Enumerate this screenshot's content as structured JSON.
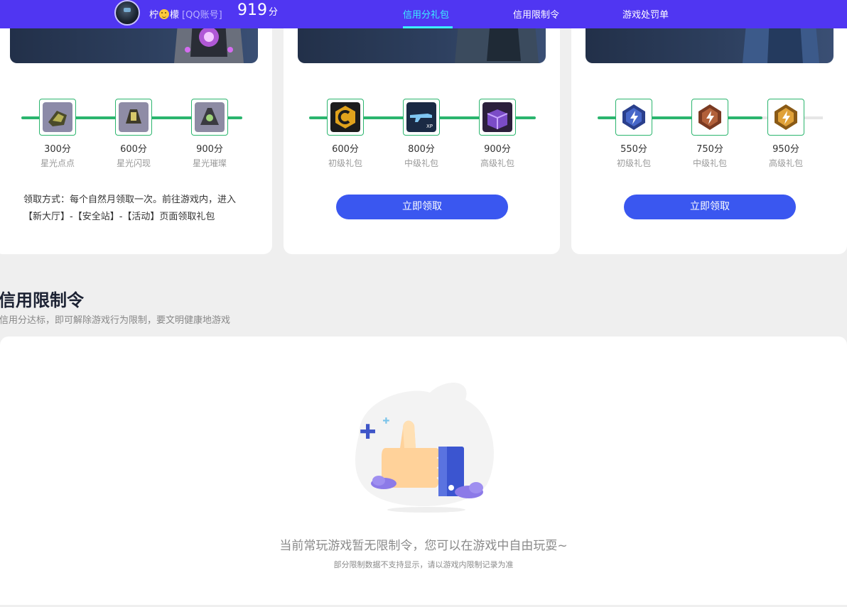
{
  "header": {
    "user_name_prefix": "柠",
    "user_name_suffix": "檬",
    "account_label": "[QQ账号]",
    "score": "919",
    "score_unit": "分",
    "nav": [
      {
        "label": "信用分礼包",
        "active": true
      },
      {
        "label": "信用限制令",
        "active": false
      },
      {
        "label": "游戏处罚单",
        "active": false
      }
    ]
  },
  "gift_cards": [
    {
      "tiers": [
        {
          "points": "300分",
          "name": "星光点点",
          "icon": "starlight-item-1"
        },
        {
          "points": "600分",
          "name": "星光闪现",
          "icon": "starlight-item-2"
        },
        {
          "points": "900分",
          "name": "星光璀璨",
          "icon": "starlight-item-3"
        }
      ],
      "howto": "领取方式：每个自然月领取一次。前往游戏内，进入【新大厅】-【安全站】-【活动】页面领取礼包"
    },
    {
      "tiers": [
        {
          "points": "600分",
          "name": "初级礼包",
          "icon": "c-badge-icon"
        },
        {
          "points": "800分",
          "name": "中级礼包",
          "icon": "rifle-xp-icon"
        },
        {
          "points": "900分",
          "name": "高级礼包",
          "icon": "purple-crate-icon"
        }
      ],
      "button": "立即领取"
    },
    {
      "tiers": [
        {
          "points": "550分",
          "name": "初级礼包",
          "icon": "blue-rank-badge-icon"
        },
        {
          "points": "750分",
          "name": "中级礼包",
          "icon": "bronze-rank-badge-icon"
        },
        {
          "points": "950分",
          "name": "高级礼包",
          "icon": "gold-rank-badge-icon"
        }
      ],
      "button": "立即领取"
    }
  ],
  "restriction_section": {
    "title": "信用限制令",
    "subtitle": "信用分达标，即可解除游戏行为限制，要文明健康地游戏",
    "empty_message": "当前常玩游戏暂无限制令，您可以在游戏中自由玩耍~",
    "empty_note": "部分限制数据不支持显示，请以游戏内限制记录为准"
  },
  "colors": {
    "topbar": "#5036f2",
    "nav_active": "#3cf0ff",
    "progress": "#2bb56e",
    "button": "#3a57f0"
  }
}
